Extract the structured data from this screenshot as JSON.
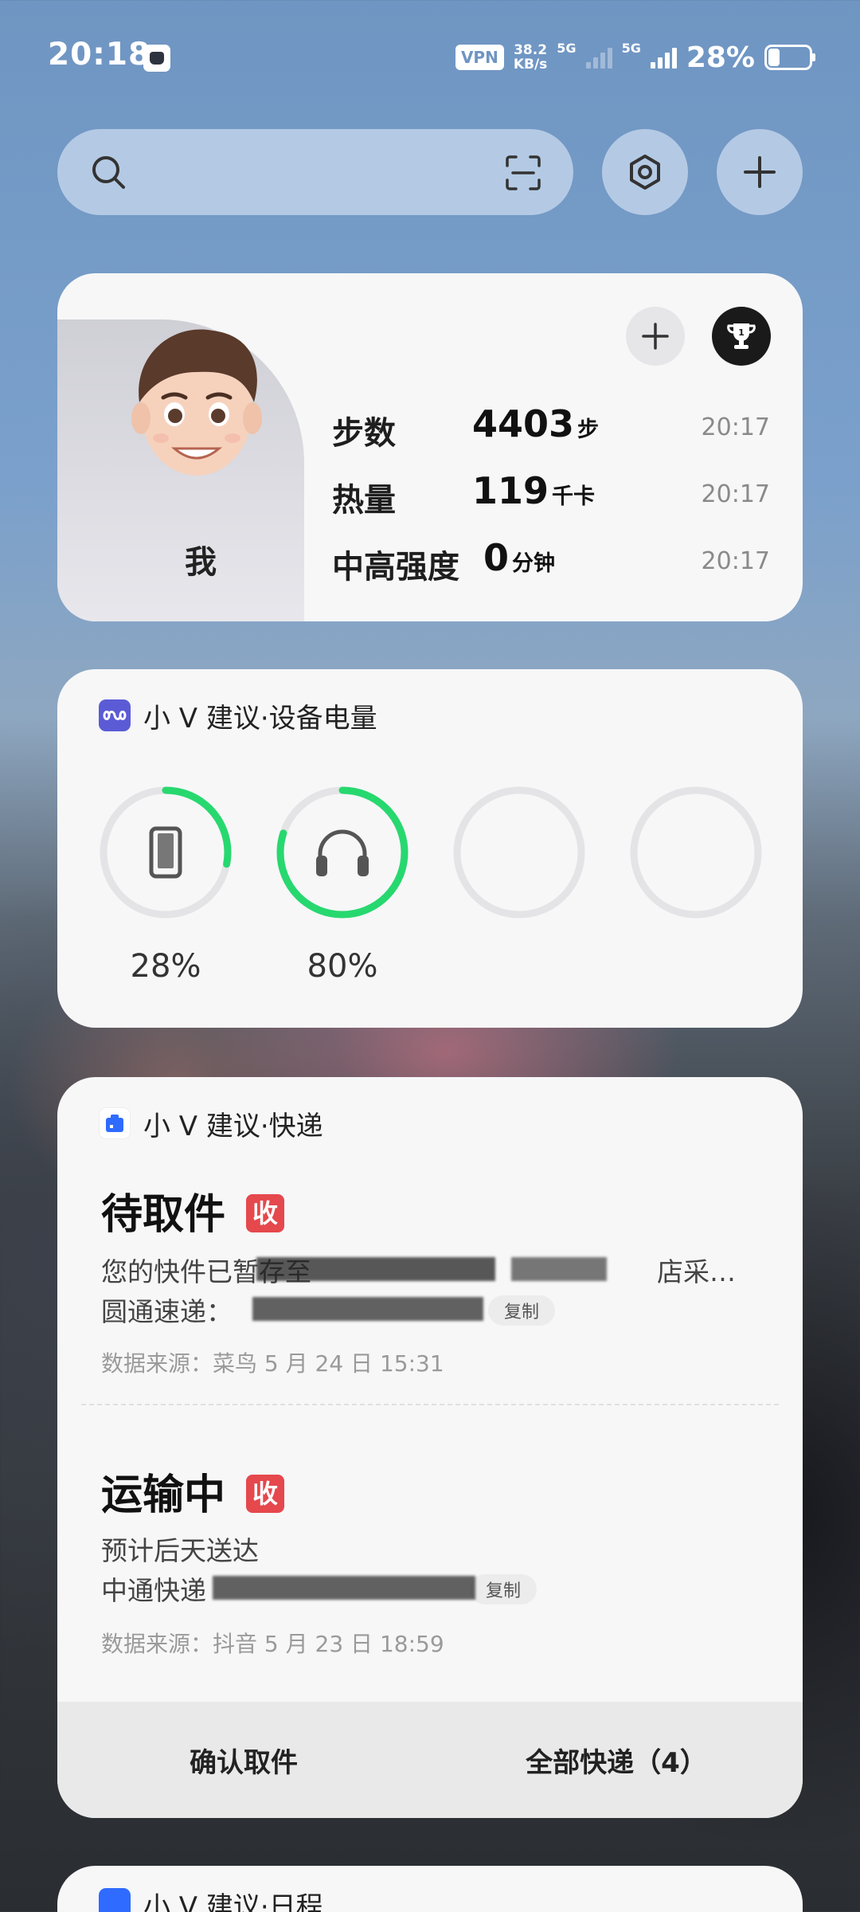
{
  "status_bar": {
    "time": "20:18",
    "vpn": "VPN",
    "speed_value": "38.2",
    "speed_unit": "KB/s",
    "net_1": "5G",
    "net_2": "5G",
    "battery": "28%"
  },
  "search": {
    "icons": [
      "search-icon",
      "scan-icon",
      "settings-icon",
      "add-icon"
    ]
  },
  "health": {
    "name": "我",
    "steps": {
      "label": "步数",
      "value": "4403",
      "unit": "步",
      "time": "20:17"
    },
    "calories": {
      "label": "热量",
      "value": "119",
      "unit": "千卡",
      "time": "20:17"
    },
    "intensity": {
      "label": "中高强度",
      "value": "0",
      "unit": "分钟",
      "time": "20:17"
    }
  },
  "battery_card": {
    "title": "小 V 建议·设备电量",
    "devices": [
      {
        "icon": "phone-icon",
        "percent": "28%",
        "level": 0.28
      },
      {
        "icon": "headphones-icon",
        "percent": "80%",
        "level": 0.8
      },
      {
        "icon": "",
        "percent": "",
        "level": 0
      },
      {
        "icon": "",
        "percent": "",
        "level": 0
      }
    ],
    "accent": "#27d86f"
  },
  "express_card": {
    "title": "小 V 建议·快递",
    "packages": [
      {
        "status": "待取件",
        "badge": "收",
        "line1": "您的快件已暂存至",
        "line1_end": "店采…",
        "line2_label": "圆通速递：",
        "copy": "复制",
        "source": "数据来源：菜鸟  5 月 24 日  15:31"
      },
      {
        "status": "运输中",
        "badge": "收",
        "line1": "预计后天送达",
        "line2_label": "中通快递",
        "copy": "复制",
        "source": "数据来源：抖音  5 月 23 日  18:59"
      }
    ],
    "footer": {
      "confirm": "确认取件",
      "all": "全部快递（4）"
    }
  },
  "next_card": {
    "title": "小 V 建议·日程"
  }
}
